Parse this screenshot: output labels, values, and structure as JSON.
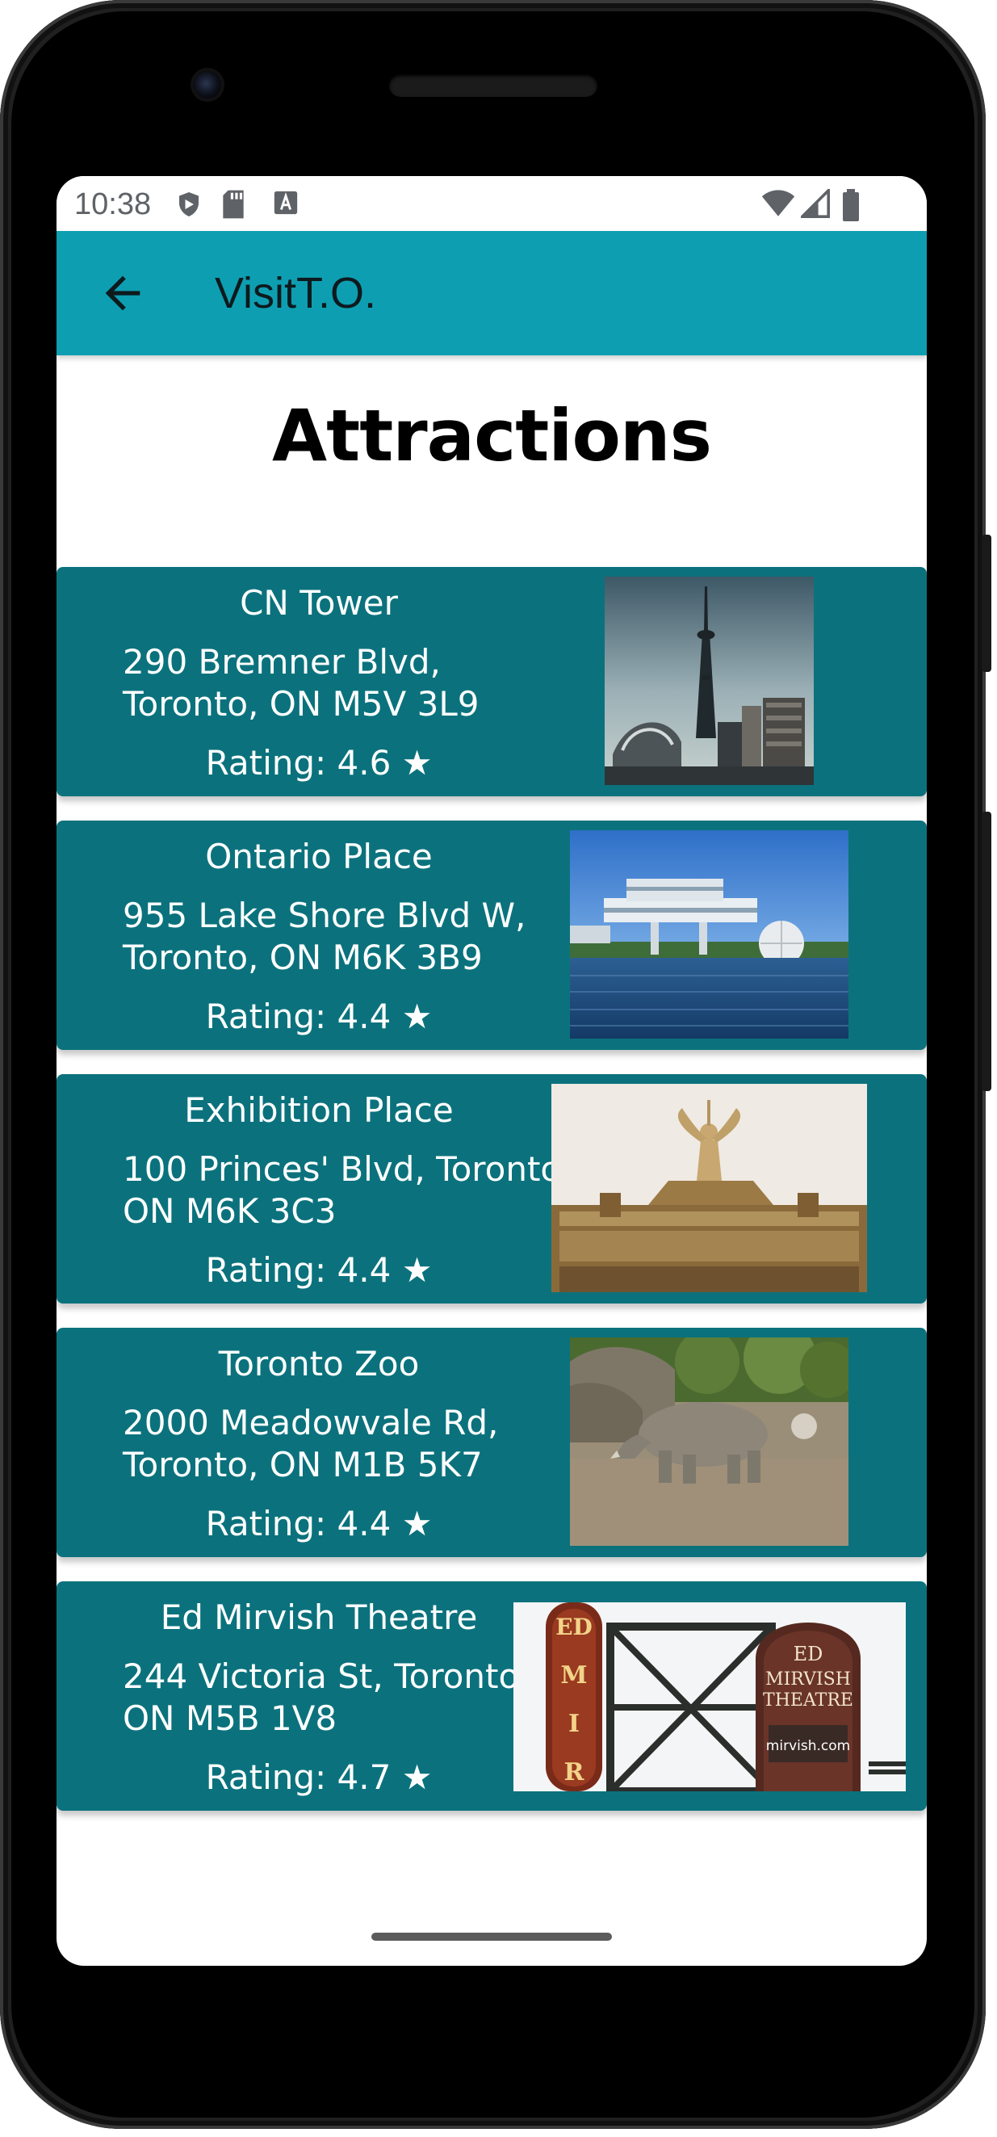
{
  "status_bar": {
    "time": "10:38",
    "left_icons": [
      "shield-icon",
      "sd-card-icon",
      "text-a-icon"
    ],
    "right_icons": [
      "wifi-icon",
      "signal-icon",
      "battery-icon"
    ]
  },
  "app_bar": {
    "back_icon": "arrow-back-icon",
    "title": "VisitT.O.",
    "color": "#0e9eb1"
  },
  "page": {
    "heading": "Attractions"
  },
  "attractions": [
    {
      "name": "CN Tower",
      "address": "290 Bremner Blvd, Toronto, ON M5V 3L9",
      "rating": "Rating: 4.6 ★",
      "image": "cn-tower-photo"
    },
    {
      "name": "Ontario Place",
      "address": "955 Lake Shore Blvd W, Toronto, ON M6K 3B9",
      "rating": "Rating: 4.4 ★",
      "image": "ontario-place-photo"
    },
    {
      "name": "Exhibition Place",
      "address": "100 Princes' Blvd, Toronto, ON M6K 3C3",
      "rating": "Rating: 4.4 ★",
      "image": "exhibition-place-photo"
    },
    {
      "name": "Toronto Zoo",
      "address": "2000 Meadowvale Rd, Toronto, ON M1B 5K7",
      "rating": "Rating: 4.4 ★",
      "image": "toronto-zoo-photo"
    },
    {
      "name": "Ed Mirvish Theatre",
      "address": "244 Victoria St, Toronto, ON M5B 1V8",
      "rating": "Rating: 4.7 ★",
      "image": "ed-mirvish-theatre-photo",
      "sign_text": [
        "ED",
        "M",
        "I",
        "R",
        "ED",
        "MIRVISH",
        "THEATRE",
        "mirvish.com"
      ]
    }
  ],
  "colors": {
    "card": "#0b727d",
    "card_text": "#ffffff"
  }
}
